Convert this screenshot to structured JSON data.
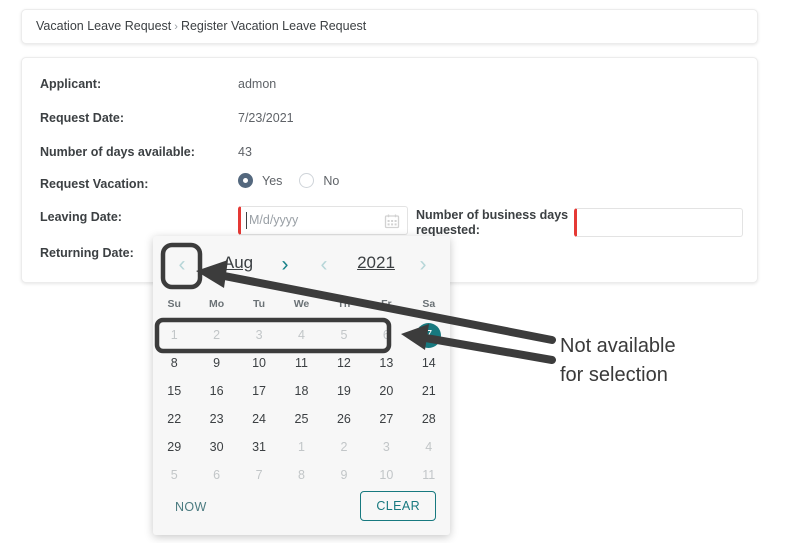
{
  "breadcrumb": {
    "parent": "Vacation Leave Request",
    "separator": "›",
    "current": "Register Vacation Leave Request"
  },
  "form": {
    "applicant": {
      "label": "Applicant:",
      "value": "admon"
    },
    "request_date": {
      "label": "Request Date:",
      "value": "7/23/2021"
    },
    "days_available": {
      "label": "Number of days available:",
      "value": "43"
    },
    "request_vacation": {
      "label": "Request Vacation:",
      "options": [
        {
          "label": "Yes",
          "selected": true
        },
        {
          "label": "No",
          "selected": false
        }
      ]
    },
    "leaving_date": {
      "label": "Leaving Date:",
      "value": "",
      "placeholder": "M/d/yyyy",
      "icon": "calendar-icon",
      "required_marker_color": "#e53935"
    },
    "returning_date": {
      "label": "Returning Date:",
      "value": ""
    },
    "business_days": {
      "label": "Number of business days requested:",
      "value": "",
      "placeholder": "",
      "required_marker_color": "#e53935"
    }
  },
  "calendar": {
    "prev_month_icon": "chevron-left-icon",
    "next_month_icon": "chevron-right-icon",
    "prev_year_icon": "chevron-left-icon",
    "next_year_icon": "chevron-right-icon",
    "month": "Aug",
    "year": "2021",
    "weekdays": [
      "Su",
      "Mo",
      "Tu",
      "We",
      "Th",
      "Fr",
      "Sa"
    ],
    "days": [
      {
        "n": "1",
        "state": "disabled"
      },
      {
        "n": "2",
        "state": "disabled"
      },
      {
        "n": "3",
        "state": "disabled"
      },
      {
        "n": "4",
        "state": "disabled"
      },
      {
        "n": "5",
        "state": "disabled"
      },
      {
        "n": "6",
        "state": "disabled"
      },
      {
        "n": "7",
        "state": "today"
      },
      {
        "n": "8",
        "state": "normal"
      },
      {
        "n": "9",
        "state": "normal"
      },
      {
        "n": "10",
        "state": "normal"
      },
      {
        "n": "11",
        "state": "normal"
      },
      {
        "n": "12",
        "state": "normal"
      },
      {
        "n": "13",
        "state": "normal"
      },
      {
        "n": "14",
        "state": "normal"
      },
      {
        "n": "15",
        "state": "normal"
      },
      {
        "n": "16",
        "state": "normal"
      },
      {
        "n": "17",
        "state": "normal"
      },
      {
        "n": "18",
        "state": "normal"
      },
      {
        "n": "19",
        "state": "normal"
      },
      {
        "n": "20",
        "state": "normal"
      },
      {
        "n": "21",
        "state": "normal"
      },
      {
        "n": "22",
        "state": "normal"
      },
      {
        "n": "23",
        "state": "normal"
      },
      {
        "n": "24",
        "state": "normal"
      },
      {
        "n": "25",
        "state": "normal"
      },
      {
        "n": "26",
        "state": "normal"
      },
      {
        "n": "27",
        "state": "normal"
      },
      {
        "n": "28",
        "state": "normal"
      },
      {
        "n": "29",
        "state": "normal"
      },
      {
        "n": "30",
        "state": "normal"
      },
      {
        "n": "31",
        "state": "normal"
      },
      {
        "n": "1",
        "state": "outside"
      },
      {
        "n": "2",
        "state": "outside"
      },
      {
        "n": "3",
        "state": "outside"
      },
      {
        "n": "4",
        "state": "outside"
      },
      {
        "n": "5",
        "state": "outside"
      },
      {
        "n": "6",
        "state": "outside"
      },
      {
        "n": "7",
        "state": "outside"
      },
      {
        "n": "8",
        "state": "outside"
      },
      {
        "n": "9",
        "state": "outside"
      },
      {
        "n": "10",
        "state": "outside"
      },
      {
        "n": "11",
        "state": "outside"
      }
    ],
    "now_label": "NOW",
    "clear_label": "CLEAR",
    "today_color": "#17797f",
    "accent_color": "#17797f"
  },
  "annotation": {
    "text": "Not available\nfor selection",
    "color": "#3a3a3a",
    "highlight_boxes": [
      "prev-month-arrow",
      "disabled-week-row"
    ],
    "arrow_count": 2
  }
}
